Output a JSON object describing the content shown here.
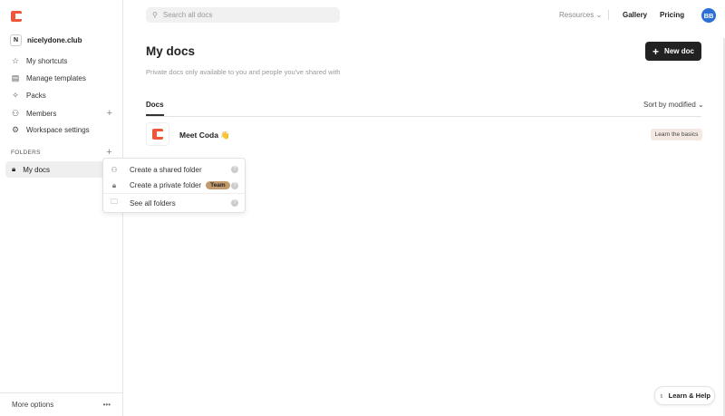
{
  "sidebar": {
    "workspace_initial": "N",
    "workspace": "nicelydone.club",
    "items": [
      {
        "label": "My shortcuts"
      },
      {
        "label": "Manage templates"
      },
      {
        "label": "Packs"
      },
      {
        "label": "Members"
      },
      {
        "label": "Workspace settings"
      }
    ],
    "folders_label": "FOLDERS",
    "my_docs": "My docs",
    "more_options": "More options"
  },
  "header": {
    "search_placeholder": "Search all docs",
    "resources": "Resources",
    "gallery": "Gallery",
    "pricing": "Pricing",
    "avatar": "BB"
  },
  "main": {
    "title": "My docs",
    "subtitle": "Private docs only available to you and people you've shared with",
    "new_doc": "New doc",
    "tab": "Docs",
    "sort": "Sort by modified",
    "docs": [
      {
        "title": "Meet Coda 👋",
        "action": "Learn the basics"
      }
    ]
  },
  "menu": {
    "items": [
      {
        "label": "Create a shared folder"
      },
      {
        "label": "Create a private folder",
        "badge": "Team"
      },
      {
        "label": "See all folders"
      }
    ]
  },
  "help": "Learn & Help"
}
